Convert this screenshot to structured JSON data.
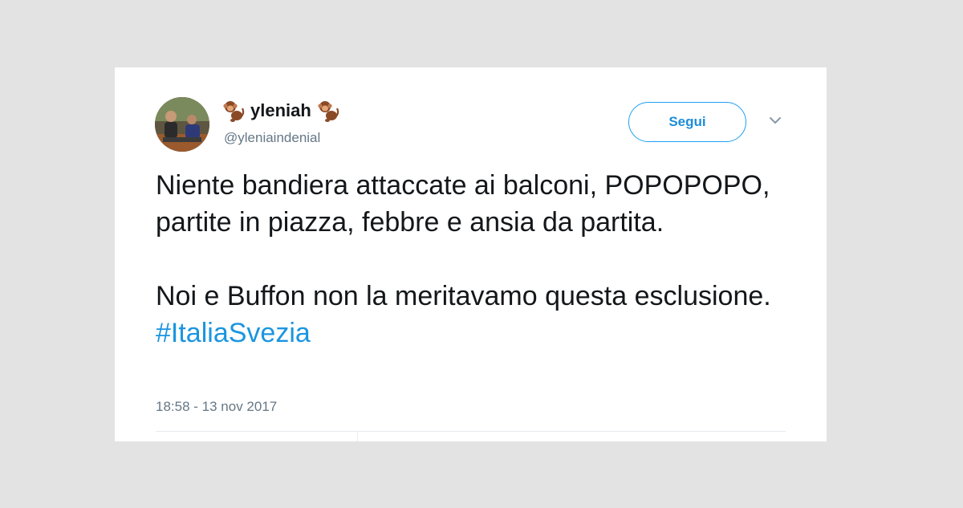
{
  "tweet": {
    "author": {
      "display_name": "yleniah",
      "handle": "@yleniaindenial",
      "name_emoji": "monkey-icon"
    },
    "follow_label": "Segui",
    "text": {
      "paragraph_1": "Niente bandiera attaccate ai balconi, POPOPOPO, partite in piazza, febbre e ansia da partita.",
      "paragraph_2_text": "Noi e Buffon non la meritavamo questa esclusione.",
      "hashtag": "#ItaliaSvezia"
    },
    "timestamp": "18:58 - 13 nov 2017"
  },
  "colors": {
    "background": "#e3e3e3",
    "card": "#ffffff",
    "link_blue": "#1b95e0",
    "secondary_text": "#657786",
    "primary_text": "#14171a"
  }
}
